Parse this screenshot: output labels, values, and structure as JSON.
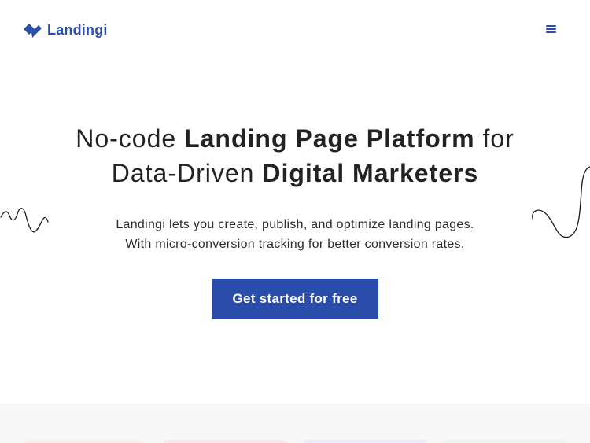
{
  "header": {
    "logo_text": "Landingi",
    "logo_icon": "landingi-logo-icon",
    "menu_icon": "hamburger-menu-icon"
  },
  "hero": {
    "headline": {
      "line1": {
        "pre": "No-code ",
        "bold": "Landing Page Platform",
        "post": " for"
      },
      "line2": {
        "pre": "Data-Driven ",
        "bold": "Digital Marketers"
      }
    },
    "subtext_line1": "Landingi lets you create, publish, and optimize landing pages.",
    "subtext_line2": "With micro-conversion tracking for better conversion rates.",
    "cta_label": "Get started for free"
  },
  "colors": {
    "brand": "#2a4caa",
    "text": "#222222",
    "band": "#f7f7f8",
    "card_1": "#fdeee8",
    "card_2": "#fde7ec",
    "card_3": "#ebebfb",
    "card_4": "#e8f6ee"
  }
}
